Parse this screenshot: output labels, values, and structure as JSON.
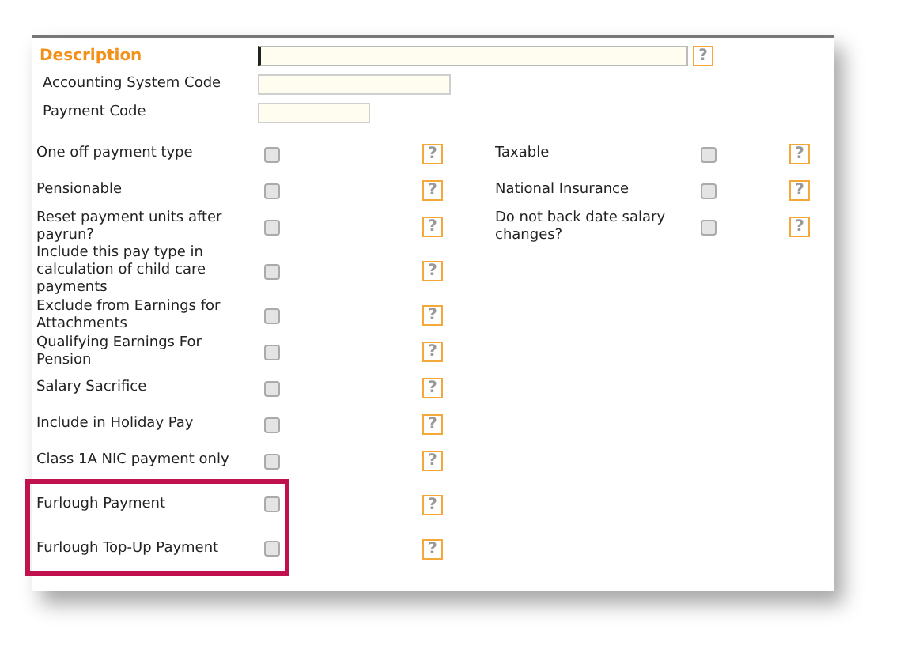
{
  "fields": [
    {
      "label": "Description",
      "required": true,
      "focused": true,
      "kind": "long"
    },
    {
      "label": "Accounting System Code",
      "required": false,
      "focused": false,
      "kind": "medium"
    },
    {
      "label": "Payment Code",
      "required": false,
      "focused": false,
      "kind": "short"
    }
  ],
  "rows": [
    {
      "left": {
        "label": "One off payment type",
        "checked": false
      },
      "right": {
        "label": "Taxable",
        "checked": false
      }
    },
    {
      "left": {
        "label": "Pensionable",
        "checked": false
      },
      "right": {
        "label": "National Insurance",
        "checked": false
      }
    },
    {
      "left": {
        "label": "Reset payment units after payrun?",
        "checked": false
      },
      "right": {
        "label": "Do not back date salary changes?",
        "checked": false
      }
    },
    {
      "left": {
        "label": "Include this pay type in calculation of child care payments",
        "checked": false
      }
    },
    {
      "left": {
        "label": "Exclude from Earnings for Attachments",
        "checked": false
      }
    },
    {
      "left": {
        "label": "Qualifying Earnings For Pension",
        "checked": false
      }
    },
    {
      "left": {
        "label": "Salary Sacrifice",
        "checked": false
      }
    },
    {
      "left": {
        "label": "Include in Holiday Pay",
        "checked": false
      }
    },
    {
      "left": {
        "label": "Class 1A NIC payment only",
        "checked": false
      }
    }
  ],
  "highlighted_rows": [
    {
      "left": {
        "label": "Furlough Payment",
        "checked": false
      }
    },
    {
      "left": {
        "label": "Furlough Top-Up Payment",
        "checked": false
      }
    }
  ],
  "help_mark": "?"
}
